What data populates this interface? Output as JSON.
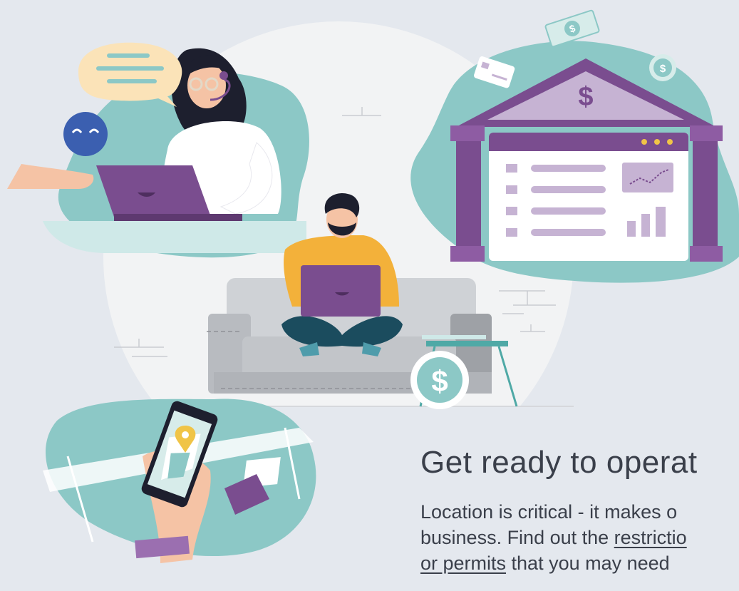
{
  "content": {
    "headline": "Get ready to operat",
    "line1": "Location is critical - it makes o",
    "line2_prefix": "business. Find out the ",
    "line2_link": "restrictio",
    "line3_link": "or permits",
    "line3_suffix": " that you may need"
  },
  "colors": {
    "background": "#e4e8ee",
    "teal": "#8cc8c6",
    "purple": "#7a4d8f",
    "lavender": "#c6b3d3",
    "text": "#3a3f4a"
  },
  "icons": [
    "speech-bubble-icon",
    "smiley-face-icon",
    "dollar-bill-icon",
    "credit-card-icon",
    "dollar-coin-icon",
    "bank-building-icon",
    "map-pin-icon",
    "wallet-icon"
  ]
}
